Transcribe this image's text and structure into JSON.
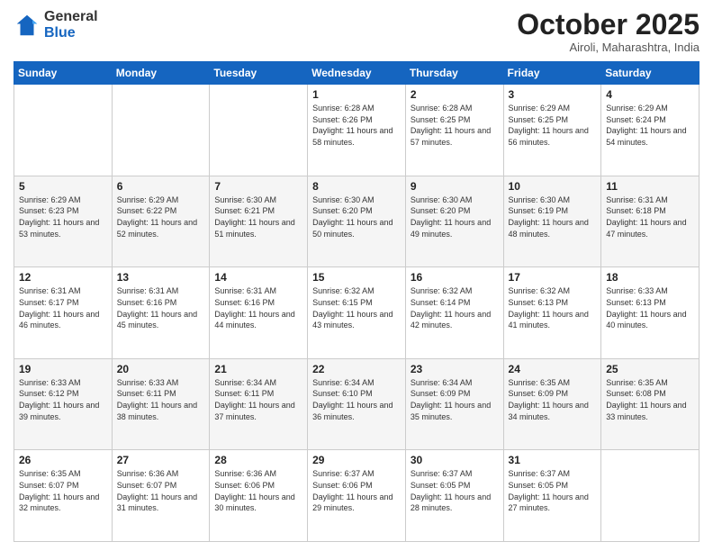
{
  "header": {
    "logo_general": "General",
    "logo_blue": "Blue",
    "month_title": "October 2025",
    "subtitle": "Airoli, Maharashtra, India"
  },
  "weekdays": [
    "Sunday",
    "Monday",
    "Tuesday",
    "Wednesday",
    "Thursday",
    "Friday",
    "Saturday"
  ],
  "weeks": [
    [
      {
        "day": "",
        "sunrise": "",
        "sunset": "",
        "daylight": ""
      },
      {
        "day": "",
        "sunrise": "",
        "sunset": "",
        "daylight": ""
      },
      {
        "day": "",
        "sunrise": "",
        "sunset": "",
        "daylight": ""
      },
      {
        "day": "1",
        "sunrise": "Sunrise: 6:28 AM",
        "sunset": "Sunset: 6:26 PM",
        "daylight": "Daylight: 11 hours and 58 minutes."
      },
      {
        "day": "2",
        "sunrise": "Sunrise: 6:28 AM",
        "sunset": "Sunset: 6:25 PM",
        "daylight": "Daylight: 11 hours and 57 minutes."
      },
      {
        "day": "3",
        "sunrise": "Sunrise: 6:29 AM",
        "sunset": "Sunset: 6:25 PM",
        "daylight": "Daylight: 11 hours and 56 minutes."
      },
      {
        "day": "4",
        "sunrise": "Sunrise: 6:29 AM",
        "sunset": "Sunset: 6:24 PM",
        "daylight": "Daylight: 11 hours and 54 minutes."
      }
    ],
    [
      {
        "day": "5",
        "sunrise": "Sunrise: 6:29 AM",
        "sunset": "Sunset: 6:23 PM",
        "daylight": "Daylight: 11 hours and 53 minutes."
      },
      {
        "day": "6",
        "sunrise": "Sunrise: 6:29 AM",
        "sunset": "Sunset: 6:22 PM",
        "daylight": "Daylight: 11 hours and 52 minutes."
      },
      {
        "day": "7",
        "sunrise": "Sunrise: 6:30 AM",
        "sunset": "Sunset: 6:21 PM",
        "daylight": "Daylight: 11 hours and 51 minutes."
      },
      {
        "day": "8",
        "sunrise": "Sunrise: 6:30 AM",
        "sunset": "Sunset: 6:20 PM",
        "daylight": "Daylight: 11 hours and 50 minutes."
      },
      {
        "day": "9",
        "sunrise": "Sunrise: 6:30 AM",
        "sunset": "Sunset: 6:20 PM",
        "daylight": "Daylight: 11 hours and 49 minutes."
      },
      {
        "day": "10",
        "sunrise": "Sunrise: 6:30 AM",
        "sunset": "Sunset: 6:19 PM",
        "daylight": "Daylight: 11 hours and 48 minutes."
      },
      {
        "day": "11",
        "sunrise": "Sunrise: 6:31 AM",
        "sunset": "Sunset: 6:18 PM",
        "daylight": "Daylight: 11 hours and 47 minutes."
      }
    ],
    [
      {
        "day": "12",
        "sunrise": "Sunrise: 6:31 AM",
        "sunset": "Sunset: 6:17 PM",
        "daylight": "Daylight: 11 hours and 46 minutes."
      },
      {
        "day": "13",
        "sunrise": "Sunrise: 6:31 AM",
        "sunset": "Sunset: 6:16 PM",
        "daylight": "Daylight: 11 hours and 45 minutes."
      },
      {
        "day": "14",
        "sunrise": "Sunrise: 6:31 AM",
        "sunset": "Sunset: 6:16 PM",
        "daylight": "Daylight: 11 hours and 44 minutes."
      },
      {
        "day": "15",
        "sunrise": "Sunrise: 6:32 AM",
        "sunset": "Sunset: 6:15 PM",
        "daylight": "Daylight: 11 hours and 43 minutes."
      },
      {
        "day": "16",
        "sunrise": "Sunrise: 6:32 AM",
        "sunset": "Sunset: 6:14 PM",
        "daylight": "Daylight: 11 hours and 42 minutes."
      },
      {
        "day": "17",
        "sunrise": "Sunrise: 6:32 AM",
        "sunset": "Sunset: 6:13 PM",
        "daylight": "Daylight: 11 hours and 41 minutes."
      },
      {
        "day": "18",
        "sunrise": "Sunrise: 6:33 AM",
        "sunset": "Sunset: 6:13 PM",
        "daylight": "Daylight: 11 hours and 40 minutes."
      }
    ],
    [
      {
        "day": "19",
        "sunrise": "Sunrise: 6:33 AM",
        "sunset": "Sunset: 6:12 PM",
        "daylight": "Daylight: 11 hours and 39 minutes."
      },
      {
        "day": "20",
        "sunrise": "Sunrise: 6:33 AM",
        "sunset": "Sunset: 6:11 PM",
        "daylight": "Daylight: 11 hours and 38 minutes."
      },
      {
        "day": "21",
        "sunrise": "Sunrise: 6:34 AM",
        "sunset": "Sunset: 6:11 PM",
        "daylight": "Daylight: 11 hours and 37 minutes."
      },
      {
        "day": "22",
        "sunrise": "Sunrise: 6:34 AM",
        "sunset": "Sunset: 6:10 PM",
        "daylight": "Daylight: 11 hours and 36 minutes."
      },
      {
        "day": "23",
        "sunrise": "Sunrise: 6:34 AM",
        "sunset": "Sunset: 6:09 PM",
        "daylight": "Daylight: 11 hours and 35 minutes."
      },
      {
        "day": "24",
        "sunrise": "Sunrise: 6:35 AM",
        "sunset": "Sunset: 6:09 PM",
        "daylight": "Daylight: 11 hours and 34 minutes."
      },
      {
        "day": "25",
        "sunrise": "Sunrise: 6:35 AM",
        "sunset": "Sunset: 6:08 PM",
        "daylight": "Daylight: 11 hours and 33 minutes."
      }
    ],
    [
      {
        "day": "26",
        "sunrise": "Sunrise: 6:35 AM",
        "sunset": "Sunset: 6:07 PM",
        "daylight": "Daylight: 11 hours and 32 minutes."
      },
      {
        "day": "27",
        "sunrise": "Sunrise: 6:36 AM",
        "sunset": "Sunset: 6:07 PM",
        "daylight": "Daylight: 11 hours and 31 minutes."
      },
      {
        "day": "28",
        "sunrise": "Sunrise: 6:36 AM",
        "sunset": "Sunset: 6:06 PM",
        "daylight": "Daylight: 11 hours and 30 minutes."
      },
      {
        "day": "29",
        "sunrise": "Sunrise: 6:37 AM",
        "sunset": "Sunset: 6:06 PM",
        "daylight": "Daylight: 11 hours and 29 minutes."
      },
      {
        "day": "30",
        "sunrise": "Sunrise: 6:37 AM",
        "sunset": "Sunset: 6:05 PM",
        "daylight": "Daylight: 11 hours and 28 minutes."
      },
      {
        "day": "31",
        "sunrise": "Sunrise: 6:37 AM",
        "sunset": "Sunset: 6:05 PM",
        "daylight": "Daylight: 11 hours and 27 minutes."
      },
      {
        "day": "",
        "sunrise": "",
        "sunset": "",
        "daylight": ""
      }
    ]
  ]
}
